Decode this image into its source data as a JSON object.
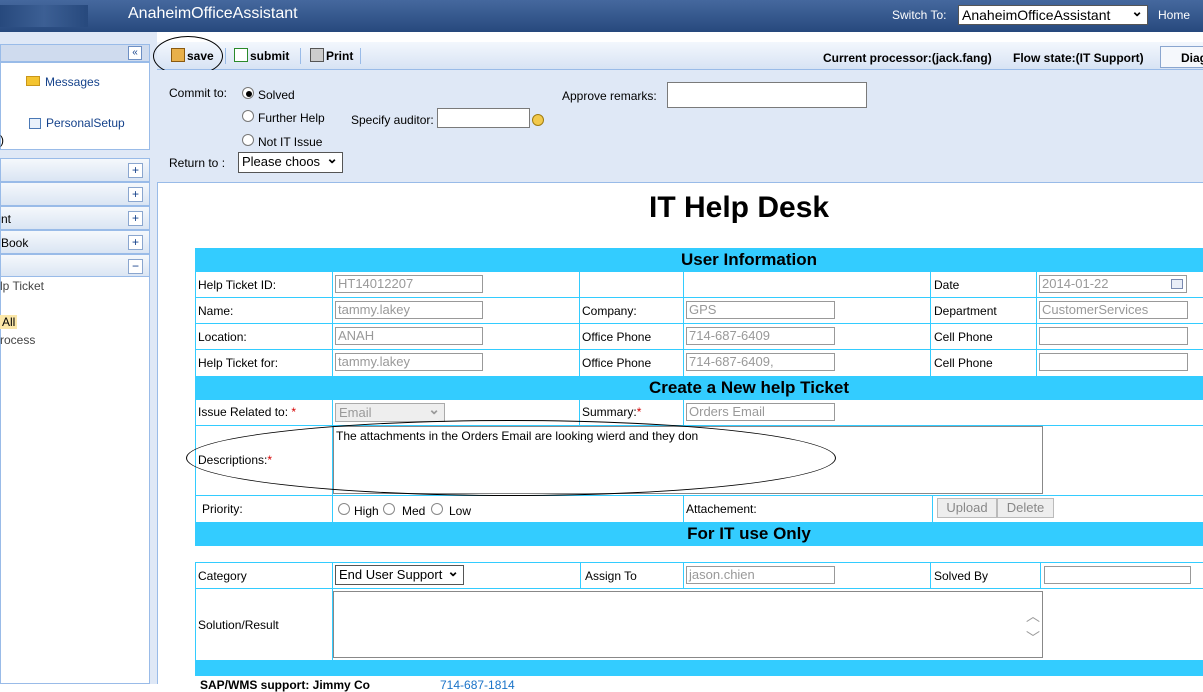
{
  "app": {
    "title": "AnaheimOfficeAssistant",
    "switch_to_label": "Switch To:",
    "switch_to_value": "AnaheimOfficeAssistant",
    "home": "Home"
  },
  "sidebar": {
    "messages": "Messages",
    "personal_setup": "PersonalSetup",
    "sections": [
      {
        "label": "",
        "toggle": "+"
      },
      {
        "label": "",
        "toggle": "+"
      },
      {
        "label": "nt",
        "toggle": "+"
      },
      {
        "label": "Book",
        "toggle": "+"
      },
      {
        "label": "",
        "toggle": "−"
      }
    ],
    "list": [
      "lp Ticket",
      "All",
      "rocess"
    ],
    "collapse": "«"
  },
  "toolbar": {
    "save": "save",
    "submit": "submit",
    "print": "Print",
    "current_processor": "Current processor:(jack.fang)",
    "flow_state": "Flow state:(IT Support)",
    "diagram": "Diag"
  },
  "commit": {
    "label": "Commit to:",
    "options": [
      "Solved",
      "Further Help",
      "Not IT Issue"
    ],
    "selected": "Solved",
    "specify_auditor": "Specify auditor:",
    "approve_remarks": "Approve remarks:",
    "return_to": "Return to :",
    "return_to_value": "Please choos"
  },
  "form": {
    "title": "IT Help Desk",
    "user_info_header": "User Information",
    "help_ticket_id_label": "Help Ticket ID:",
    "help_ticket_id": "HT14012207",
    "date_label": "Date",
    "date": "2014-01-22",
    "name_label": "Name:",
    "name": "tammy.lakey",
    "company_label": "Company:",
    "company": "GPS",
    "department_label": "Department",
    "department": "CustomerServices",
    "location_label": "Location:",
    "location": "ANAH",
    "office_phone_label": "Office Phone",
    "office_phone": "714-687-6409",
    "cell_phone_label": "Cell Phone",
    "help_ticket_for_label": "Help Ticket for:",
    "help_ticket_for": "tammy.lakey",
    "office_phone2": "714-687-6409,",
    "new_ticket_header": "Create a New help Ticket",
    "issue_related_label": "Issue Related to:",
    "issue_related": "Email",
    "summary_label": "Summary:",
    "summary": "Orders Email",
    "descriptions_label": "Descriptions:",
    "descriptions": "The attachments in the Orders Email are looking wierd and they don",
    "priority_label": "Priority:",
    "priority_options": [
      "High",
      "Med",
      "Low"
    ],
    "attachment_label": "Attachement:",
    "upload": "Upload",
    "delete": "Delete",
    "it_use_header": "For IT use Only",
    "category_label": "Category",
    "category": "End User Support",
    "assign_to_label": "Assign To",
    "assign_to": "jason.chien",
    "solved_by_label": "Solved By",
    "solution_label": "Solution/Result",
    "footer_partial": "SAP/WMS support: Jimmy Co",
    "footer_phone": "714-687-1814",
    "required_mark": "*"
  }
}
